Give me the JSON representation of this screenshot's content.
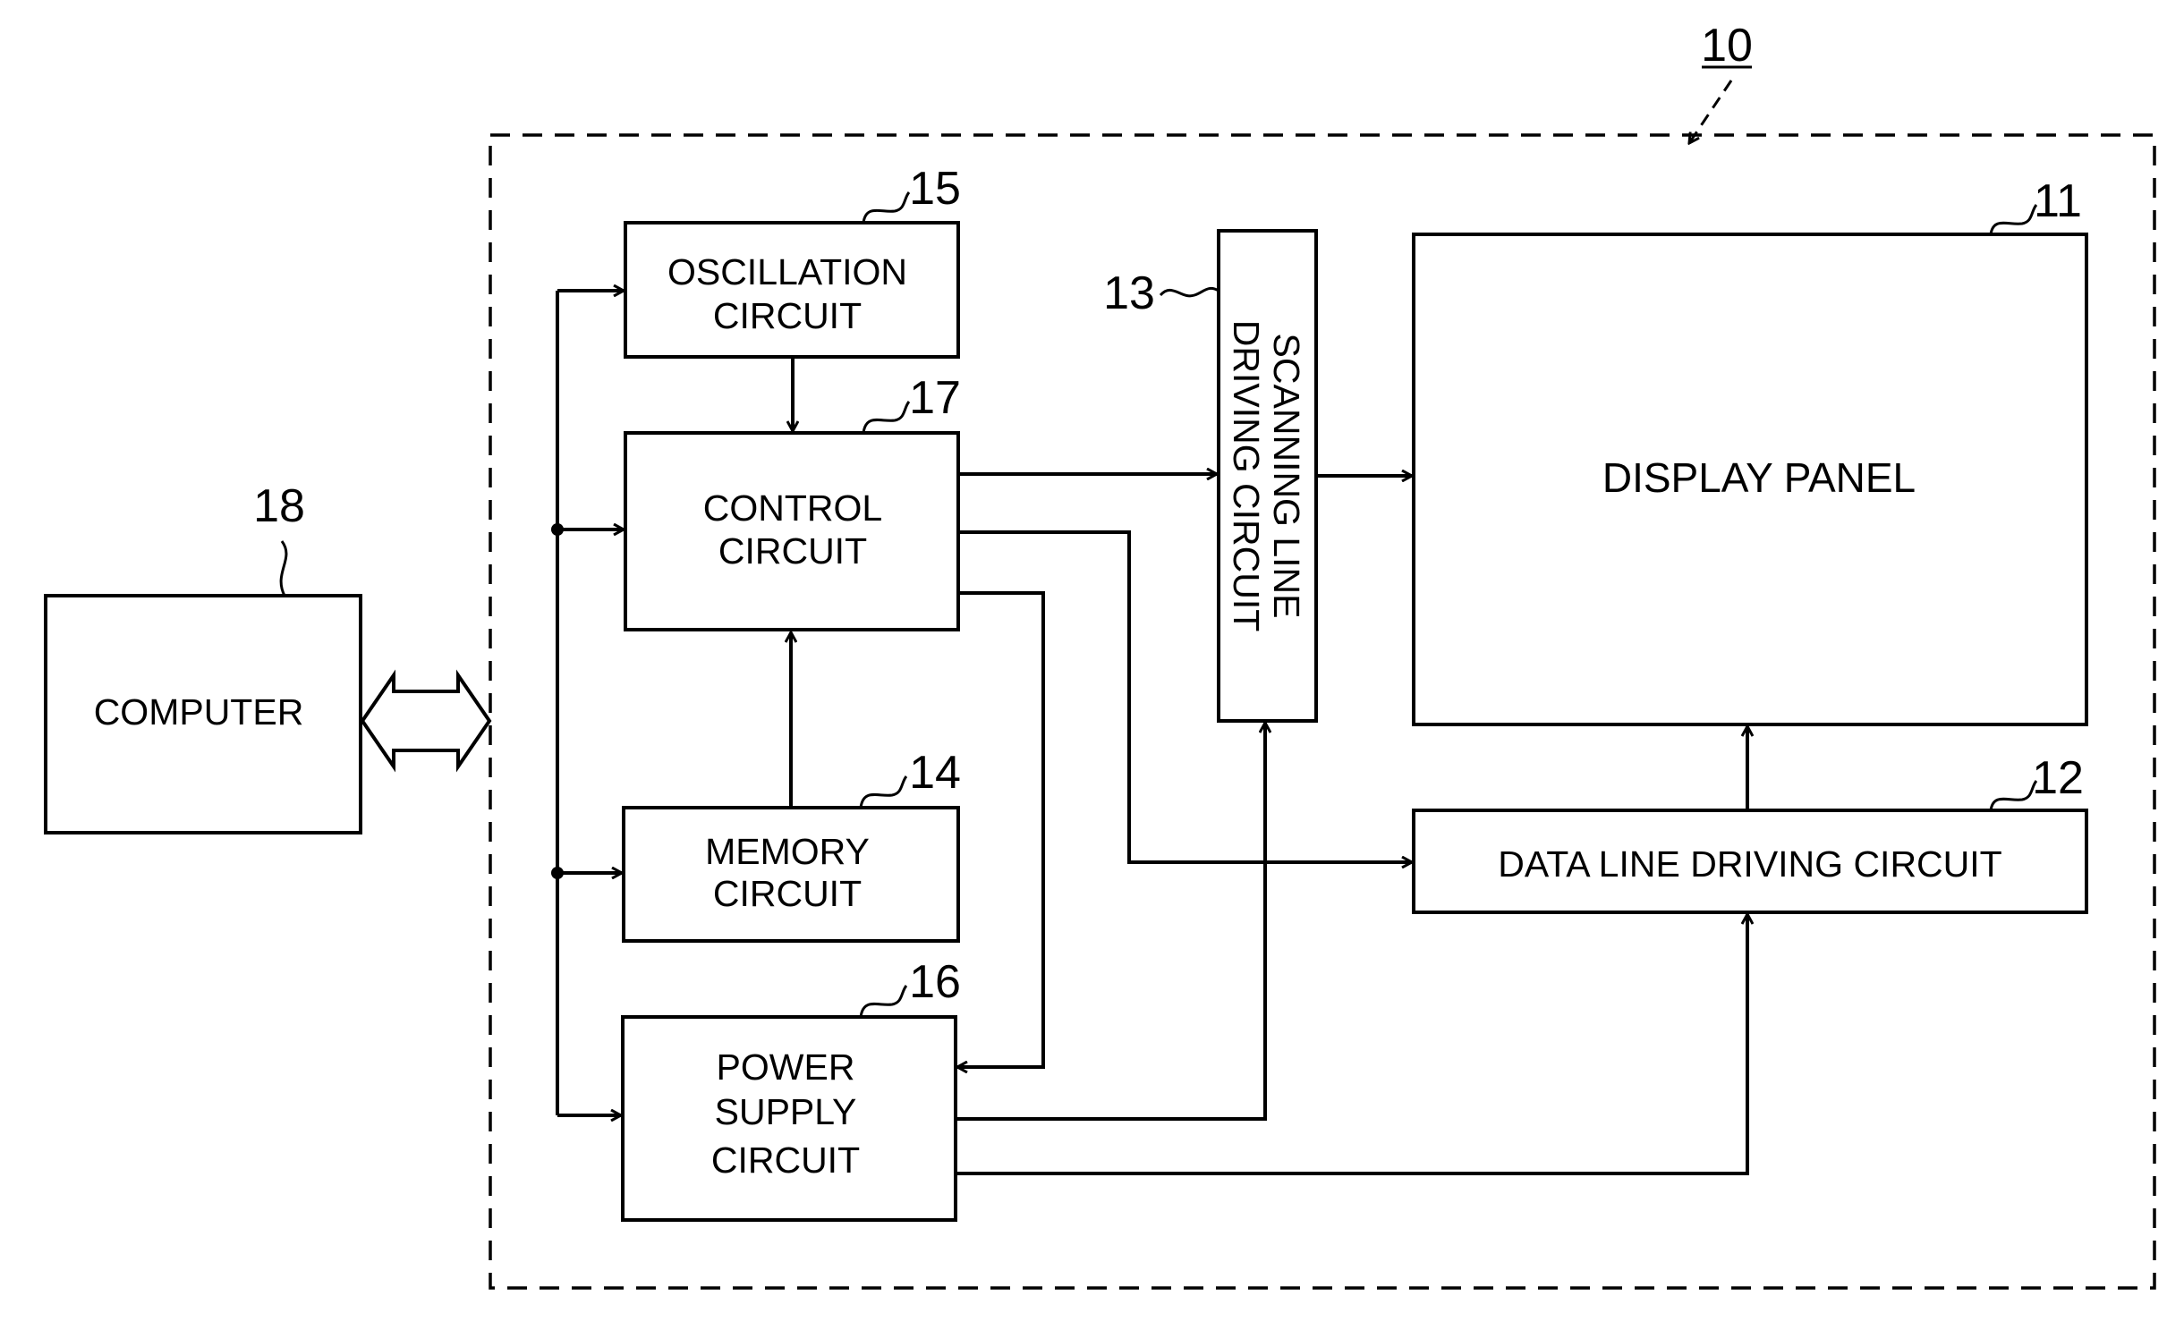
{
  "figure": {
    "system_ref": "10",
    "blocks": {
      "display_panel": {
        "ref": "11",
        "lines": [
          "DISPLAY PANEL"
        ]
      },
      "data_line": {
        "ref": "12",
        "lines": [
          "DATA LINE DRIVING CIRCUIT"
        ]
      },
      "scanning_line": {
        "ref": "13",
        "lines": [
          "SCANNING LINE",
          "DRIVING CIRCUIT"
        ]
      },
      "memory": {
        "ref": "14",
        "lines": [
          "MEMORY",
          "CIRCUIT"
        ]
      },
      "oscillation": {
        "ref": "15",
        "lines": [
          "OSCILLATION",
          "CIRCUIT"
        ]
      },
      "power_supply": {
        "ref": "16",
        "lines": [
          "POWER",
          "SUPPLY",
          "CIRCUIT"
        ]
      },
      "control": {
        "ref": "17",
        "lines": [
          "CONTROL",
          "CIRCUIT"
        ]
      },
      "computer": {
        "ref": "18",
        "lines": [
          "COMPUTER"
        ]
      }
    },
    "colors": {
      "ink": "#000000",
      "background": "#ffffff"
    }
  }
}
